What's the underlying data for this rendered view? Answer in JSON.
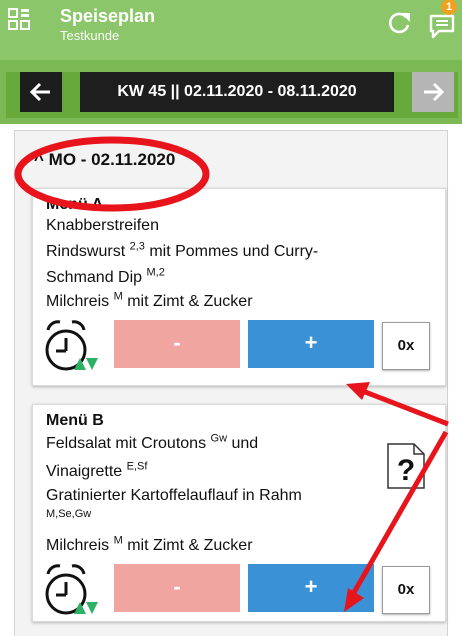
{
  "app": {
    "title": "Speiseplan",
    "subtitle": "Testkunde",
    "notification_count": "1"
  },
  "week": {
    "label": "KW 45 || 02.11.2020 - 08.11.2020"
  },
  "day": {
    "caret": "^",
    "label": "MO - 02.11.2020"
  },
  "menus": [
    {
      "title": "Menü A",
      "line1": "Knabberstreifen",
      "line2a": "Rindswurst",
      "line2a_sup": "2,3",
      "line2b": " mit Pommes und Curry-",
      "line3": "Schmand Dip",
      "line3_sup": "M,2",
      "line4": "Milchreis",
      "line4_sup": "M",
      "line4b": " mit Zimt & Zucker",
      "minus_label": "-",
      "plus_label": "+",
      "count": "0x"
    },
    {
      "title": "Menü B",
      "line1": "Feldsalat mit Croutons",
      "line1_sup": "Gw",
      "line1b": " und",
      "line2": "Vinaigrette",
      "line2_sup": "E,Sf",
      "line3": "Gratinierter Kartoffelauflauf in Rahm",
      "line3_allergens": "M,Se,Gw",
      "line4": "Milchreis",
      "line4_sup": "M",
      "line4b": " mit Zimt & Zucker",
      "minus_label": "-",
      "plus_label": "+",
      "count": "0x"
    }
  ],
  "colors": {
    "appbar": "#8cc66a",
    "plus": "#3b91d6",
    "minus": "#f0a5a0",
    "annotation": "#e8141c",
    "clock_triangle": "#2fb163"
  },
  "icons": [
    "app-grid-icon",
    "refresh-icon",
    "chat-icon",
    "arrow-left-icon",
    "arrow-right-icon",
    "alarm-clock-icon",
    "question-document-icon"
  ]
}
